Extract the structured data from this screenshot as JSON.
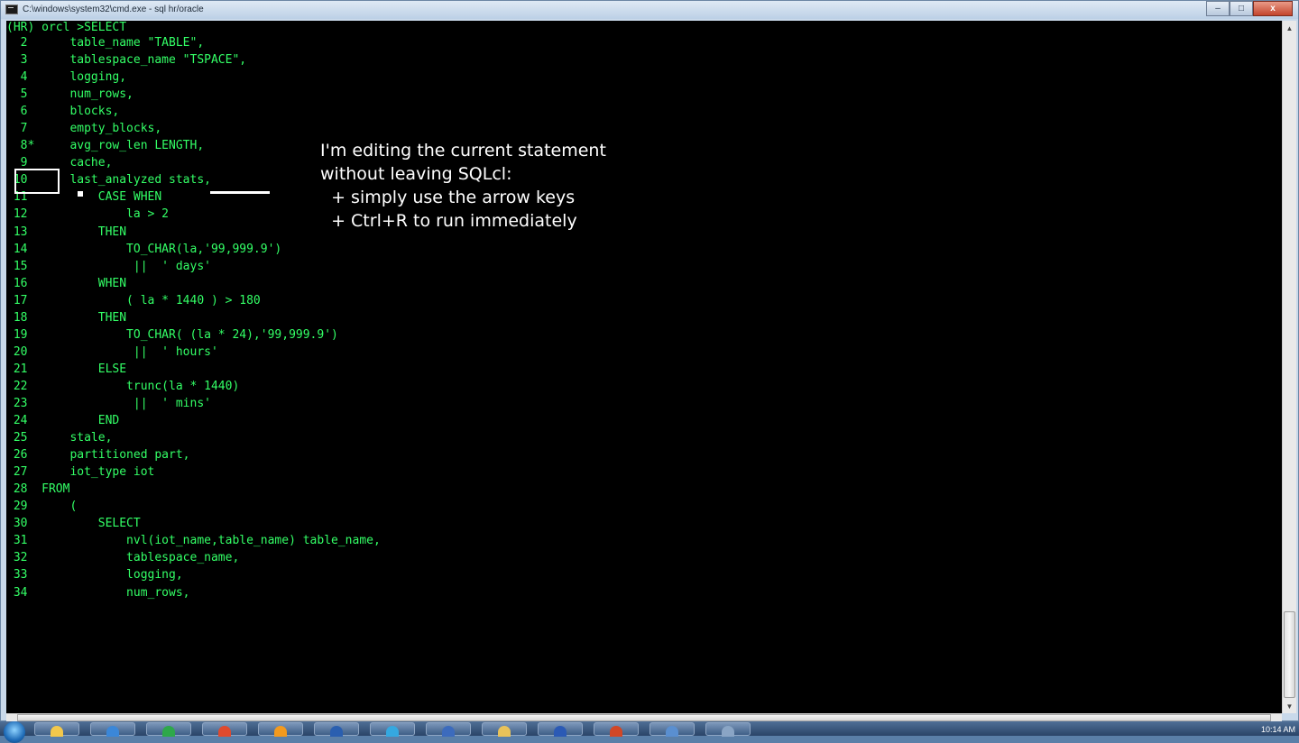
{
  "window": {
    "title": "C:\\windows\\system32\\cmd.exe - sql  hr/oracle",
    "controls": {
      "minimize": "–",
      "maximize": "□",
      "close": "x"
    }
  },
  "console": {
    "prompt": "(HR) orcl >SELECT",
    "lines": [
      "  2      table_name \"TABLE\",",
      "  3      tablespace_name \"TSPACE\",",
      "  4      logging,",
      "  5      num_rows,",
      "  6      blocks,",
      "  7      empty_blocks,",
      "  8*     avg_row_len LENGTH,",
      "  9      cache,",
      " 10      last_analyzed stats,",
      " 11          CASE WHEN",
      " 12              la > 2",
      " 13          THEN",
      " 14              TO_CHAR(la,'99,999.9')",
      " 15               ||  ' days'",
      " 16          WHEN",
      " 17              ( la * 1440 ) > 180",
      " 18          THEN",
      " 19              TO_CHAR( (la * 24),'99,999.9')",
      " 20               ||  ' hours'",
      " 21          ELSE",
      " 22              trunc(la * 1440)",
      " 23               ||  ' mins'",
      " 24          END",
      " 25      stale,",
      " 26      partitioned part,",
      " 27      iot_type iot",
      " 28  FROM",
      " 29      (",
      " 30          SELECT",
      " 31              nvl(iot_name,table_name) table_name,",
      " 32              tablespace_name,",
      " 33              logging,",
      " 34              num_rows,"
    ]
  },
  "annotation": {
    "line1": "I'm editing the current statement",
    "line2": "without leaving SQLcl:",
    "line3": "  + simply use the arrow keys",
    "line4": "  + Ctrl+R to run immediately"
  },
  "taskbar": {
    "clock": "10:14 AM",
    "icons": [
      "start-orb",
      "explorer-icon",
      "ie-icon",
      "chrome-icon",
      "media-icon",
      "firefox-icon",
      "app-icon",
      "globe-icon",
      "folder-icon",
      "word-icon",
      "powerpoint-icon",
      "monitor-icon",
      "tool-icon",
      "cmd-icon"
    ]
  }
}
